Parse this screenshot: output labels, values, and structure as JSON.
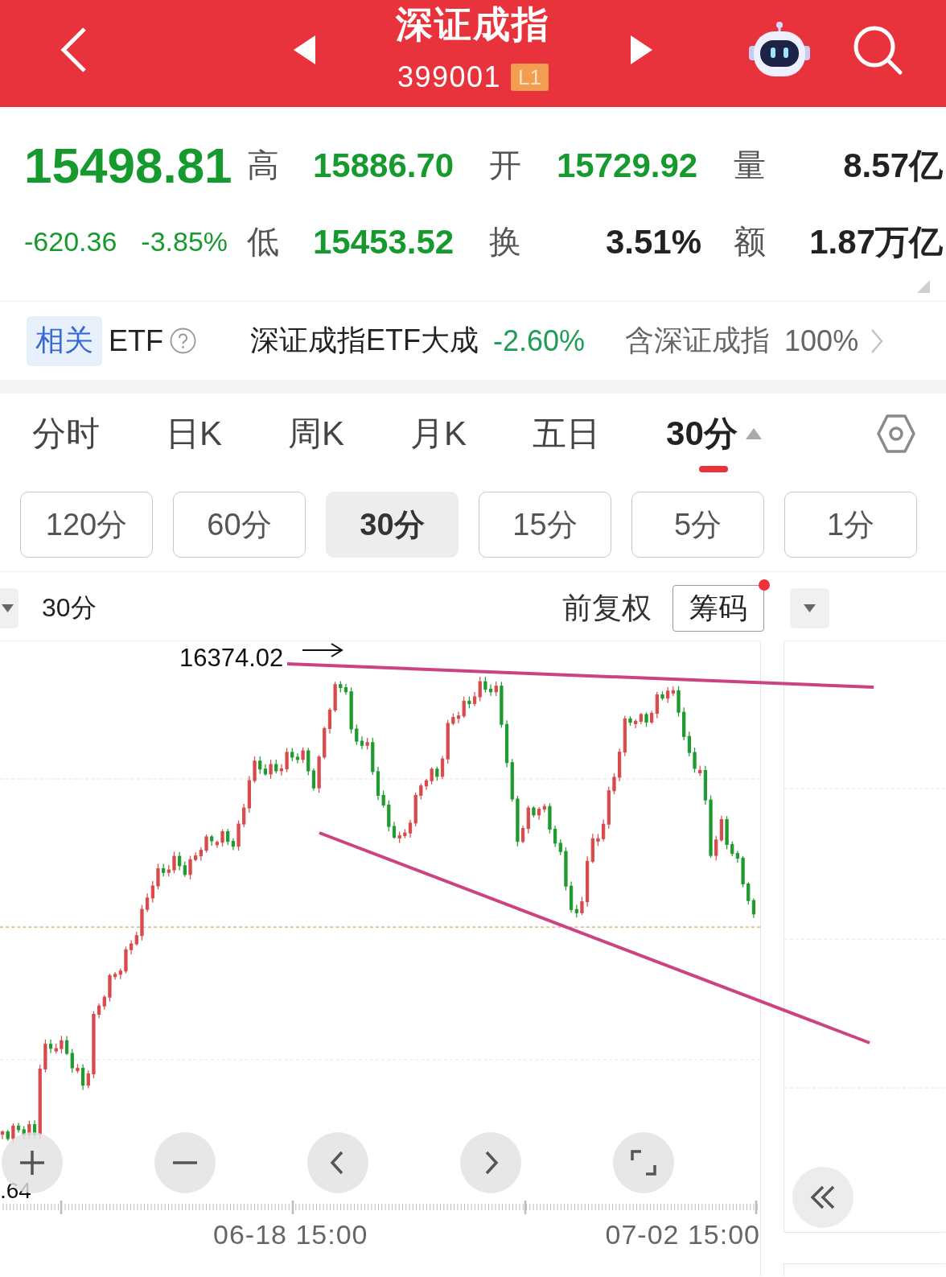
{
  "header": {
    "title": "深证成指",
    "code": "399001",
    "badge": "L1"
  },
  "quote": {
    "price": "15498.81",
    "change": "-620.36",
    "change_percent": "-3.85%",
    "stats": [
      {
        "label": "高",
        "value": "15886.70",
        "kind": "price"
      },
      {
        "label": "开",
        "value": "15729.92",
        "kind": "price"
      },
      {
        "label": "量",
        "value": "8.57亿",
        "kind": "amount"
      },
      {
        "label": "低",
        "value": "15453.52",
        "kind": "price"
      },
      {
        "label": "换",
        "value": "3.51%",
        "kind": "amount"
      },
      {
        "label": "额",
        "value": "1.87万亿",
        "kind": "amount"
      }
    ]
  },
  "related_etf": {
    "tag": "相关",
    "label": "ETF",
    "name": "深证成指ETF大成",
    "change": "-2.60%",
    "holding_label": "含深证成指",
    "holding": "100%"
  },
  "chart_tabs": [
    {
      "label": "分时",
      "selected": false,
      "dropdown": false
    },
    {
      "label": "日K",
      "selected": false,
      "dropdown": false
    },
    {
      "label": "周K",
      "selected": false,
      "dropdown": false
    },
    {
      "label": "月K",
      "selected": false,
      "dropdown": false
    },
    {
      "label": "五日",
      "selected": false,
      "dropdown": false
    },
    {
      "label": "30分",
      "selected": true,
      "dropdown": true
    }
  ],
  "periods": [
    {
      "label": "120分",
      "selected": false
    },
    {
      "label": "60分",
      "selected": false
    },
    {
      "label": "30分",
      "selected": true
    },
    {
      "label": "15分",
      "selected": false
    },
    {
      "label": "5分",
      "selected": false
    },
    {
      "label": "1分",
      "selected": false
    }
  ],
  "chart_toolbar": {
    "period": "30分",
    "adjustment": "前复权",
    "chips_button": "筹码",
    "chips_badge": true
  },
  "chart": {
    "peak_label": "16374.02",
    "low_label": ".64",
    "x_labels": [
      "06-18 15:00",
      "07-02 15:00"
    ]
  }
}
